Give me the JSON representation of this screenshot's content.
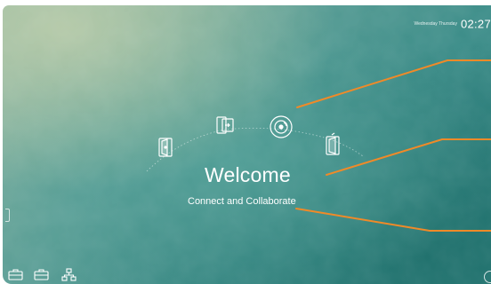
{
  "clock": {
    "date": "Wednesday Thursday",
    "time": "02:27"
  },
  "welcome": {
    "title": "Welcome",
    "subtitle": "Connect and Collaborate"
  },
  "apps": [
    {
      "name": "app-icon"
    },
    {
      "name": "input-icon"
    },
    {
      "name": "disc-icon"
    },
    {
      "name": "mirror-icon"
    }
  ],
  "taskbar": {
    "icons": [
      "toolbox-icon",
      "toolbox-icon",
      "network-icon"
    ]
  },
  "colors": {
    "annotation": "#f08a28",
    "text": "#ffffff"
  }
}
